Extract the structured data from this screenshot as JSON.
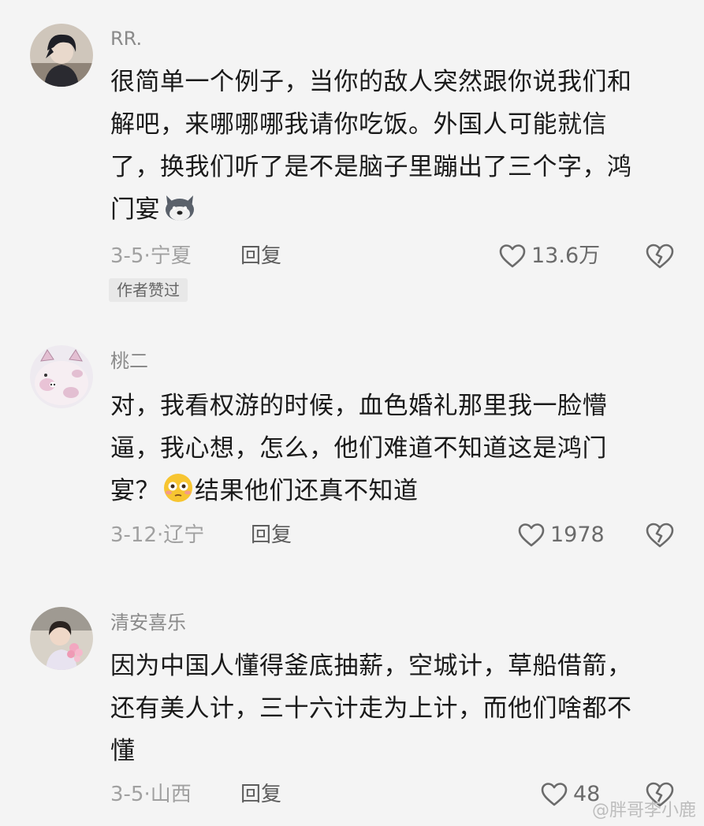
{
  "comments": [
    {
      "username": "RR.",
      "lines": [
        "很简单一个例子，当你的敌人突然跟你说我们和",
        "解吧，来哪哪哪我请你吃饭。外国人可能就信",
        "了，换我们听了是不是脑子里蹦出了三个字，鸿",
        "门宴"
      ],
      "date_location": "3-5·宁夏",
      "reply_label": "回复",
      "likes": "13.6万",
      "badge": "作者赞过"
    },
    {
      "username": "桃二",
      "lines": [
        "对，我看权游的时候，血色婚礼那里我一脸懵",
        "逼，我心想，怎么，他们难道不知道这是鸿门",
        "宴？"
      ],
      "line3_tail": "结果他们还真不知道",
      "date_location": "3-12·辽宁",
      "reply_label": "回复",
      "likes": "1978"
    },
    {
      "username": "清安喜乐",
      "lines": [
        "因为中国人懂得釜底抽薪，空城计，草船借箭，",
        "还有美人计，三十六计走为上计，而他们啥都不",
        "懂"
      ],
      "date_location": "3-5·山西",
      "reply_label": "回复",
      "likes": "48"
    }
  ],
  "watermark": "@胖哥李小鹿",
  "icons": {
    "like": "heart-outline-icon",
    "dislike": "broken-heart-icon",
    "emoji1": "husky-face-emoji",
    "emoji2": "flushed-face-emoji"
  }
}
